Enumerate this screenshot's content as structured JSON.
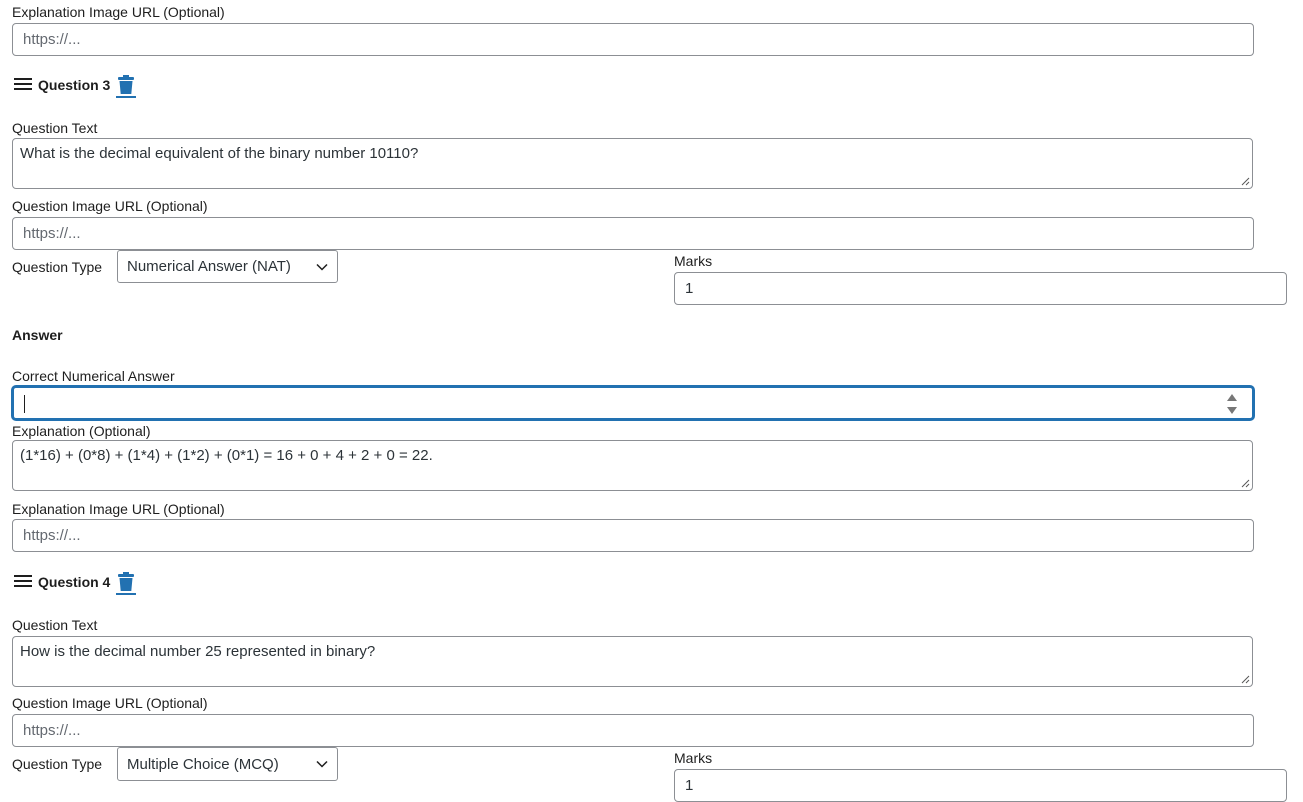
{
  "top": {
    "explanation_image_label": "Explanation Image URL (Optional)",
    "explanation_image_placeholder": "https://..."
  },
  "question3": {
    "title": "Question 3",
    "question_text_label": "Question Text",
    "question_text_value": "What is the decimal equivalent of the binary number 10110?",
    "question_image_label": "Question Image URL (Optional)",
    "question_image_placeholder": "https://...",
    "question_type_label": "Question Type",
    "question_type_value": "Numerical Answer (NAT)",
    "marks_label": "Marks",
    "marks_value": "1",
    "answer_heading": "Answer",
    "correct_answer_label": "Correct Numerical Answer",
    "correct_answer_value": "",
    "explanation_label": "Explanation (Optional)",
    "explanation_value": "(1*16) + (0*8) + (1*4) + (1*2) + (0*1) = 16 + 0 + 4 + 2 + 0 = 22.",
    "explanation_image_label": "Explanation Image URL (Optional)",
    "explanation_image_placeholder": "https://..."
  },
  "question4": {
    "title": "Question 4",
    "question_text_label": "Question Text",
    "question_text_value": "How is the decimal number 25 represented in binary?",
    "question_image_label": "Question Image URL (Optional)",
    "question_image_placeholder": "https://...",
    "question_type_label": "Question Type",
    "question_type_value": "Multiple Choice (MCQ)",
    "marks_label": "Marks",
    "marks_value": "1"
  },
  "icons": {
    "drag_handle": "hamburger-icon",
    "delete": "trash-icon",
    "dropdown": "chevron-down-icon"
  },
  "colors": {
    "accent": "#2271b1",
    "border": "#8c8f94",
    "placeholder": "#646970"
  }
}
